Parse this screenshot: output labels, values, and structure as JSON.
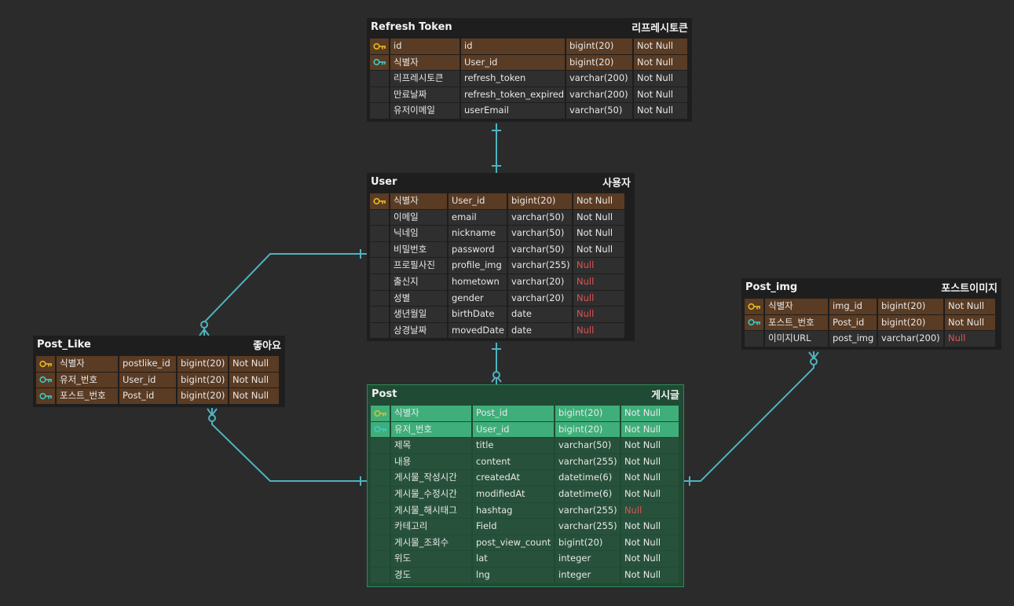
{
  "colors": {
    "background": "#2b2b2b",
    "entity_background": "#1e1e1e",
    "key_row": "#5a3b23",
    "selected_entity": "#1f4a34",
    "selected_key_row": "#3fae7a",
    "connector": "#4fb3bf",
    "primary_key_icon": "#e5b922",
    "foreign_key_icon": "#3cc9c6",
    "null_text": "#e05252"
  },
  "entities": [
    {
      "id": "refresh_token",
      "name": "Refresh Token",
      "label": "리프레시토큰",
      "columns": [
        {
          "key": "primary-key-icon",
          "logical": "id",
          "physical": "id",
          "type": "bigint(20)",
          "nullable": "Not Null"
        },
        {
          "key": "foreign-key-icon",
          "logical": "식별자",
          "physical": "User_id",
          "type": "bigint(20)",
          "nullable": "Not Null"
        },
        {
          "key": "",
          "logical": "리프레시토큰",
          "physical": "refresh_token",
          "type": "varchar(200)",
          "nullable": "Not Null"
        },
        {
          "key": "",
          "logical": "만료날짜",
          "physical": "refresh_token_expired",
          "type": "varchar(200)",
          "nullable": "Not Null"
        },
        {
          "key": "",
          "logical": "유저이메일",
          "physical": "userEmail",
          "type": "varchar(50)",
          "nullable": "Not Null"
        }
      ]
    },
    {
      "id": "user",
      "name": "User",
      "label": "사용자",
      "columns": [
        {
          "key": "primary-key-icon",
          "logical": "식별자",
          "physical": "User_id",
          "type": "bigint(20)",
          "nullable": "Not Null"
        },
        {
          "key": "",
          "logical": "이메일",
          "physical": "email",
          "type": "varchar(50)",
          "nullable": "Not Null"
        },
        {
          "key": "",
          "logical": "닉네임",
          "physical": "nickname",
          "type": "varchar(50)",
          "nullable": "Not Null"
        },
        {
          "key": "",
          "logical": "비밀번호",
          "physical": "password",
          "type": "varchar(50)",
          "nullable": "Not Null"
        },
        {
          "key": "",
          "logical": "프로필사진",
          "physical": "profile_img",
          "type": "varchar(255)",
          "nullable": "Null"
        },
        {
          "key": "",
          "logical": "출신지",
          "physical": "hometown",
          "type": "varchar(20)",
          "nullable": "Null"
        },
        {
          "key": "",
          "logical": "성별",
          "physical": "gender",
          "type": "varchar(20)",
          "nullable": "Null"
        },
        {
          "key": "",
          "logical": "생년월일",
          "physical": "birthDate",
          "type": "date",
          "nullable": "Null"
        },
        {
          "key": "",
          "logical": "상경날짜",
          "physical": "movedDate",
          "type": "date",
          "nullable": "Null"
        }
      ]
    },
    {
      "id": "post_like",
      "name": "Post_Like",
      "label": "좋아요",
      "columns": [
        {
          "key": "primary-key-icon",
          "logical": "식별자",
          "physical": "postlike_id",
          "type": "bigint(20)",
          "nullable": "Not Null"
        },
        {
          "key": "foreign-key-icon",
          "logical": "유저_번호",
          "physical": "User_id",
          "type": "bigint(20)",
          "nullable": "Not Null"
        },
        {
          "key": "foreign-key-icon",
          "logical": "포스트_번호",
          "physical": "Post_id",
          "type": "bigint(20)",
          "nullable": "Not Null"
        }
      ]
    },
    {
      "id": "post_img",
      "name": "Post_img",
      "label": "포스트이미지",
      "columns": [
        {
          "key": "primary-key-icon",
          "logical": "식별자",
          "physical": "img_id",
          "type": "bigint(20)",
          "nullable": "Not Null"
        },
        {
          "key": "foreign-key-icon",
          "logical": "포스트_번호",
          "physical": "Post_id",
          "type": "bigint(20)",
          "nullable": "Not Null"
        },
        {
          "key": "",
          "logical": "이미지URL",
          "physical": "post_img",
          "type": "varchar(200)",
          "nullable": "Null"
        }
      ]
    },
    {
      "id": "post",
      "name": "Post",
      "label": "게시글",
      "selected": true,
      "columns": [
        {
          "key": "primary-key-icon",
          "logical": "식별자",
          "physical": "Post_id",
          "type": "bigint(20)",
          "nullable": "Not Null"
        },
        {
          "key": "foreign-key-icon",
          "logical": "유저_번호",
          "physical": "User_id",
          "type": "bigint(20)",
          "nullable": "Not Null"
        },
        {
          "key": "",
          "logical": "제목",
          "physical": "title",
          "type": "varchar(50)",
          "nullable": "Not Null"
        },
        {
          "key": "",
          "logical": "내용",
          "physical": "content",
          "type": "varchar(255)",
          "nullable": "Not Null"
        },
        {
          "key": "",
          "logical": "게시물_작성시간",
          "physical": "createdAt",
          "type": "datetime(6)",
          "nullable": "Not Null"
        },
        {
          "key": "",
          "logical": "게시물_수정시간",
          "physical": "modifiedAt",
          "type": "datetime(6)",
          "nullable": "Not Null"
        },
        {
          "key": "",
          "logical": "게시물_해시태그",
          "physical": "hashtag",
          "type": "varchar(255)",
          "nullable": "Null"
        },
        {
          "key": "",
          "logical": "카테고리",
          "physical": "Field",
          "type": "varchar(255)",
          "nullable": "Not Null"
        },
        {
          "key": "",
          "logical": "게시물_조회수",
          "physical": "post_view_count",
          "type": "bigint(20)",
          "nullable": "Not Null"
        },
        {
          "key": "",
          "logical": "위도",
          "physical": "lat",
          "type": "integer",
          "nullable": "Not Null"
        },
        {
          "key": "",
          "logical": "경도",
          "physical": "lng",
          "type": "integer",
          "nullable": "Not Null"
        }
      ]
    }
  ],
  "relationships": [
    {
      "from": "user",
      "to": "refresh_token",
      "cardinality": "one-to-one"
    },
    {
      "from": "user",
      "to": "post",
      "cardinality": "one-to-many"
    },
    {
      "from": "user",
      "to": "post_like",
      "cardinality": "one-to-many"
    },
    {
      "from": "post",
      "to": "post_like",
      "cardinality": "one-to-many"
    },
    {
      "from": "post",
      "to": "post_img",
      "cardinality": "one-to-many"
    }
  ]
}
